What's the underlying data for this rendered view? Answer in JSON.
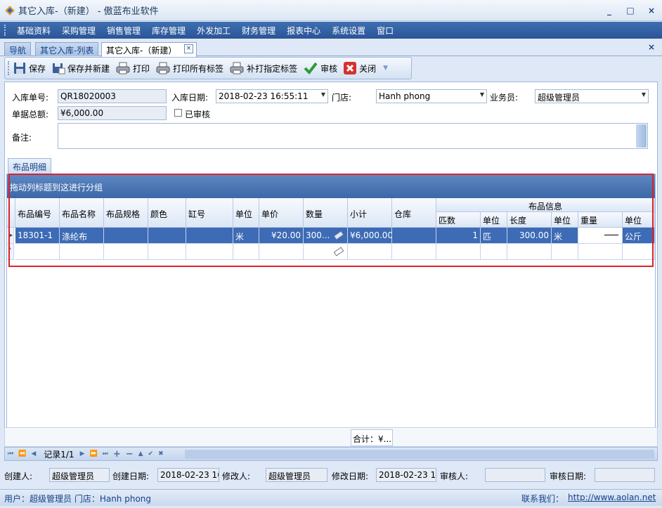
{
  "window": {
    "title": "其它入库-（新建） - 傲蓝布业软件",
    "minimize": "_",
    "restore": "□",
    "close": "×"
  },
  "menu": [
    "基础资料",
    "采购管理",
    "销售管理",
    "库存管理",
    "外发加工",
    "财务管理",
    "报表中心",
    "系统设置",
    "窗口"
  ],
  "tabs": [
    "导航",
    "其它入库-列表",
    "其它入库-（新建）"
  ],
  "tab_close": "×",
  "panel_close": "×",
  "toolbar": {
    "save": "保存",
    "save_new": "保存并新建",
    "print": "打印",
    "print_all": "打印所有标签",
    "reprint": "补打指定标签",
    "audit": "审核",
    "close": "关闭"
  },
  "form": {
    "order_no_label": "入库单号:",
    "order_no": "QR18020003",
    "date_label": "入库日期:",
    "date": "2018-02-23 16:55:11",
    "store_label": "门店:",
    "store": "Hanh phong",
    "staff_label": "业务员:",
    "staff": "超级管理员",
    "total_label": "单据总额:",
    "total": "¥6,000.00",
    "audited_label": "已审核",
    "remark_label": "备注:"
  },
  "detail_tab": "布品明细",
  "grid": {
    "group_hint": "拖动列标题到这进行分组",
    "headers": [
      "布品编号",
      "布品名称",
      "布品规格",
      "颜色",
      "缸号",
      "单位",
      "单价",
      "数量",
      "小计",
      "仓库"
    ],
    "band": "布品信息",
    "band_headers": [
      "匹数",
      "单位",
      "长度",
      "单位",
      "重量",
      "单位"
    ],
    "rows": [
      {
        "code": "18301-1",
        "name": "涤纶布",
        "spec": "",
        "color": "",
        "vat": "",
        "unit": "米",
        "price": "¥20.00",
        "qty": "300...",
        "subtotal": "¥6,000.00",
        "warehouse": "",
        "pieces": "1",
        "piece_unit": "匹",
        "length": "300.00",
        "length_unit": "米",
        "weight": "",
        "weight_unit": "公斤"
      }
    ]
  },
  "summary": {
    "total": "合计：¥..."
  },
  "navigator": {
    "record": "记录1/1"
  },
  "audit": {
    "creator_label": "创建人:",
    "creator": "超级管理员",
    "created_label": "创建日期:",
    "created": "2018-02-23 16",
    "modifier_label": "修改人:",
    "modifier": "超级管理员",
    "modified_label": "修改日期:",
    "modified": "2018-02-23 16",
    "auditor_label": "审核人:",
    "auditor": "",
    "audit_date_label": "审核日期:",
    "audit_date": ""
  },
  "status": {
    "user": "用户：超级管理员  门店：Hanh phong",
    "contact": "联系我们：",
    "url": "http://www.aolan.net"
  },
  "colors": {
    "menubar": "#2a5597",
    "selected_row": "#3d6bb5",
    "highlight_border": "#e0202a"
  }
}
